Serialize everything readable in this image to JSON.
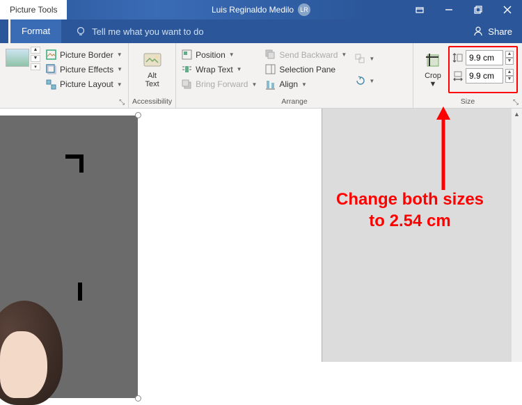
{
  "titlebar": {
    "context_tab": "Picture Tools",
    "user_name": "Luis Reginaldo Medilo",
    "user_initials": "LR"
  },
  "tabs": {
    "format": "Format",
    "tellme": "Tell me what you want to do",
    "share": "Share"
  },
  "ribbon": {
    "picture_styles": {
      "border": "Picture Border",
      "effects": "Picture Effects",
      "layout": "Picture Layout"
    },
    "accessibility": {
      "alt_text": "Alt\nText",
      "label": "Accessibility"
    },
    "arrange": {
      "position": "Position",
      "wrap_text": "Wrap Text",
      "bring_forward": "Bring Forward",
      "send_backward": "Send Backward",
      "selection_pane": "Selection Pane",
      "align": "Align",
      "label": "Arrange"
    },
    "size": {
      "crop": "Crop",
      "height_value": "9.9 cm",
      "width_value": "9.9 cm",
      "label": "Size"
    }
  },
  "annotation": {
    "line1": "Change both sizes",
    "line2": "to 2.54 cm"
  },
  "colors": {
    "highlight": "#ff0000",
    "ribbon_bg": "#f3f2f1",
    "title_bg": "#2b579a"
  }
}
